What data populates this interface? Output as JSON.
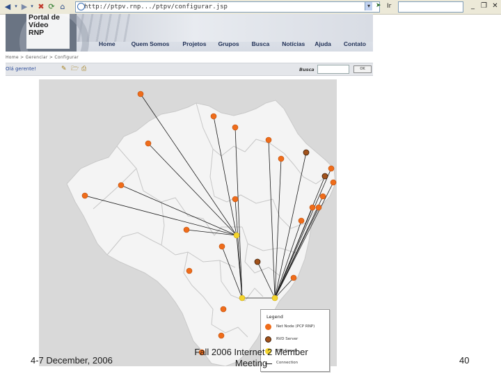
{
  "browser": {
    "address": "http://ptpv.rnp.../ptpv/configurar.jsp",
    "go_label": "Ir",
    "icons": [
      "back-icon",
      "forward-icon",
      "stop-icon",
      "refresh-icon",
      "home-icon",
      "favorites-icon",
      "history-icon",
      "go-icon",
      "minimize-icon",
      "maximize-icon",
      "close-icon"
    ]
  },
  "site": {
    "logo": "Portal de\nVídeo\nRNP",
    "nav": [
      "Home",
      "Quem Somos",
      "Projetos",
      "Grupos",
      "Busca",
      "Notícias",
      "Ajuda",
      "Contato"
    ],
    "breadcrumb": "Home  >  Gerenciar  >  Configurar",
    "greeting": "Olá gerente!",
    "search_label": "Busca",
    "search_button": "OK"
  },
  "map": {
    "colors": {
      "land": "#f4f4f4",
      "sea": "#d9d9d9",
      "border": "#c4c4c4",
      "netnode": "#ef6c1a",
      "rvd": "#a2521b",
      "server": "#f4d42c"
    },
    "legend": {
      "title": "Legend",
      "items": [
        {
          "label": "Net Node (PCP RNP)",
          "symbol": "netnode"
        },
        {
          "label": "RVD Server",
          "symbol": "rvd"
        },
        {
          "label": "PCP Server",
          "symbol": "server"
        },
        {
          "label": "Connection",
          "symbol": "line"
        }
      ]
    }
  },
  "slide": {
    "date": "4-7 December, 2006",
    "title": "Fall 2006 Internet 2 Member Meeting",
    "page": "40"
  }
}
